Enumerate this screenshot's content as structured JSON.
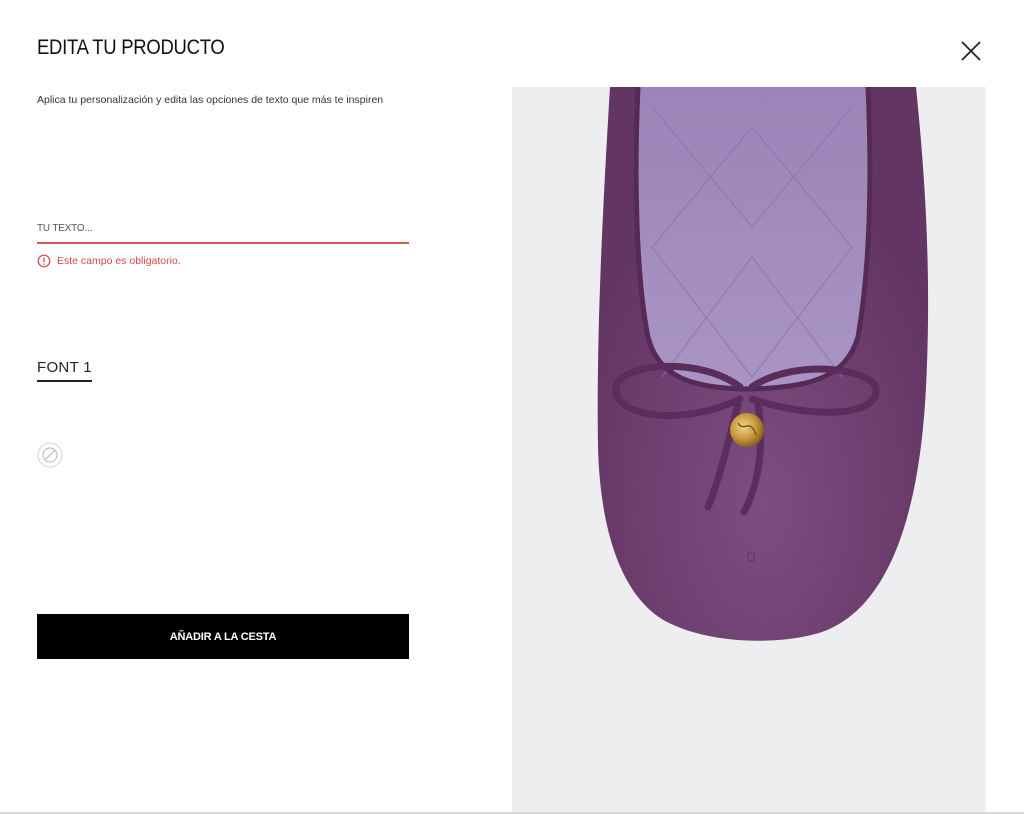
{
  "modal": {
    "title": "EDITA TU PRODUCTO",
    "description": "Aplica tu personalización y edita las opciones de texto que más te inspiren",
    "close_icon": "close-icon"
  },
  "form": {
    "text_input": {
      "placeholder": "TU TEXTO...",
      "value": ""
    },
    "error_icon": "error-circle-icon",
    "error_text": "Este campo es obligatorio.",
    "error_color": "#d84848",
    "font_option": "FONT 1",
    "no_color_icon": "no-color-icon",
    "add_button_label": "AÑADIR A LA CESTA"
  },
  "product_image": {
    "description_icon": "purple-suede-ballet-flat-image",
    "shoe_color": "#7a4a7c",
    "lining_color": "#a58fc0",
    "background_color": "#eeeef1"
  }
}
